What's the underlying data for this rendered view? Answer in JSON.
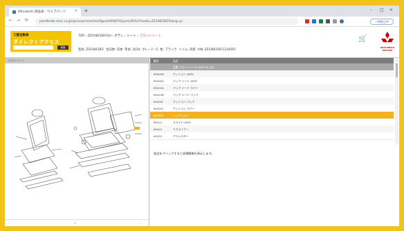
{
  "browser": {
    "tab_title": "Mitsubishi 部品表 - ウェブパーツ",
    "tab_close": "×",
    "new_tab": "+",
    "window_controls": [
      "–",
      "□",
      "×"
    ],
    "nav": [
      "←",
      "→",
      "⟳"
    ],
    "url": "partsfinder.mmc.co.jp/epc/search/sectionfigure/0004/FIG/parts/0014?model=ZZ1ABCDEF&lang=ja",
    "profile_label": "一時停止中"
  },
  "site": {
    "logo_line1": "三菱自動車",
    "logo_line2": "ダイレクトアクセス",
    "search_go": "検索",
    "breadcrumb": [
      "TOP",
      "ZZ1ABCDEFGH",
      "ボディ",
      "シート",
      "フロントシート"
    ],
    "breadcrumb_sep": "›",
    "info": [
      "型式: ZZ1ABCDEF",
      "仕向地: 日本",
      "年式: 2019",
      "グレード: G",
      "色: ブラック",
      "トリム: 内装",
      "VIN: ZZ1ABCDEF1234567"
    ],
    "brand_label": "MITSUBISHI MOTORS"
  },
  "figure": {
    "header": "フロントシート",
    "pages": [
      "‹",
      "1",
      "›"
    ]
  },
  "parts_table": {
    "headers": [
      "番号",
      "品名"
    ],
    "rows": [
      {
        "code": "",
        "name": "品番 フロントシート ASSY 右 (左)",
        "style": "grey"
      },
      {
        "code": "69400B",
        "name": "クッション ASSY",
        "style": "alt"
      },
      {
        "code": "69400A",
        "name": "バック シート ASSY",
        "style": ""
      },
      {
        "code": "69410A",
        "name": "バック シート カバー",
        "style": "alt"
      },
      {
        "code": "69410B",
        "name": "バック シート パッド",
        "style": ""
      },
      {
        "code": "69400F",
        "name": "クッション パッド",
        "style": "alt"
      },
      {
        "code": "69420C",
        "name": "クッション カバー",
        "style": ""
      },
      {
        "code": "69430E",
        "name": "ヘッドレスト",
        "style": "sel"
      },
      {
        "code": "69410",
        "name": "スライド ASSY",
        "style": ""
      },
      {
        "code": "69410",
        "name": "リクライナー",
        "style": "alt"
      },
      {
        "code": "69410",
        "name": "アジャスター",
        "style": ""
      }
    ]
  },
  "note": "部品をクリックすると詳細情報を表示します。",
  "colors": {
    "frame": "#f2c318",
    "accent": "#f3b21b",
    "logo": "#f4c400",
    "brand_red": "#cc0000"
  }
}
